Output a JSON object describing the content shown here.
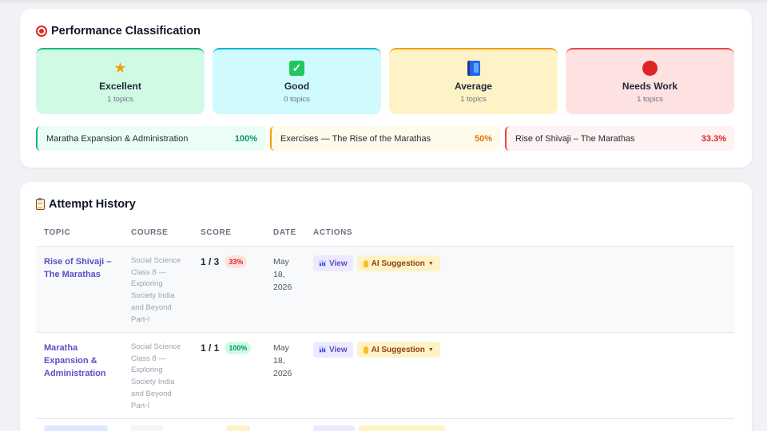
{
  "classification": {
    "title": "Performance Classification",
    "title_icon": "target-icon",
    "tiles": [
      {
        "icon": "star-icon",
        "name": "Excellent",
        "count": "1 topics",
        "color": "#10b981"
      },
      {
        "icon": "check-icon",
        "name": "Good",
        "count": "0 topics",
        "color": "#06b6d4"
      },
      {
        "icon": "book-icon",
        "name": "Average",
        "count": "1 topics",
        "color": "#f59e0b"
      },
      {
        "icon": "red-circle-icon",
        "name": "Needs Work",
        "count": "1 topics",
        "color": "#ef4444"
      }
    ],
    "topics": [
      {
        "name": "Maratha Expansion & Administration",
        "value": "100%"
      },
      {
        "name": "Exercises — The Rise of the Marathas",
        "value": "50%"
      },
      {
        "name": "Rise of Shivaji – The Marathas",
        "value": "33.3%"
      }
    ]
  },
  "history": {
    "title": "Attempt History",
    "title_icon": "clipboard-icon",
    "columns": [
      "TOPIC",
      "COURSE",
      "SCORE",
      "DATE",
      "ACTIONS"
    ],
    "rows": [
      {
        "topic": "Rise of Shivaji – The Marathas",
        "course": "Social Science Class 8 — Exploring Society India and Beyond Part-I",
        "score": "1 / 3",
        "percent": "33%",
        "date": "May 18, 2026",
        "view_label": "View",
        "ai_label": "AI Suggestion"
      },
      {
        "topic": "Maratha Expansion & Administration",
        "course": "Social Science Class 8 — Exploring Society India and Beyond Part-I",
        "score": "1 / 1",
        "percent": "100%",
        "date": "May 18, 2026",
        "view_label": "View",
        "ai_label": "AI Suggestion"
      }
    ]
  }
}
